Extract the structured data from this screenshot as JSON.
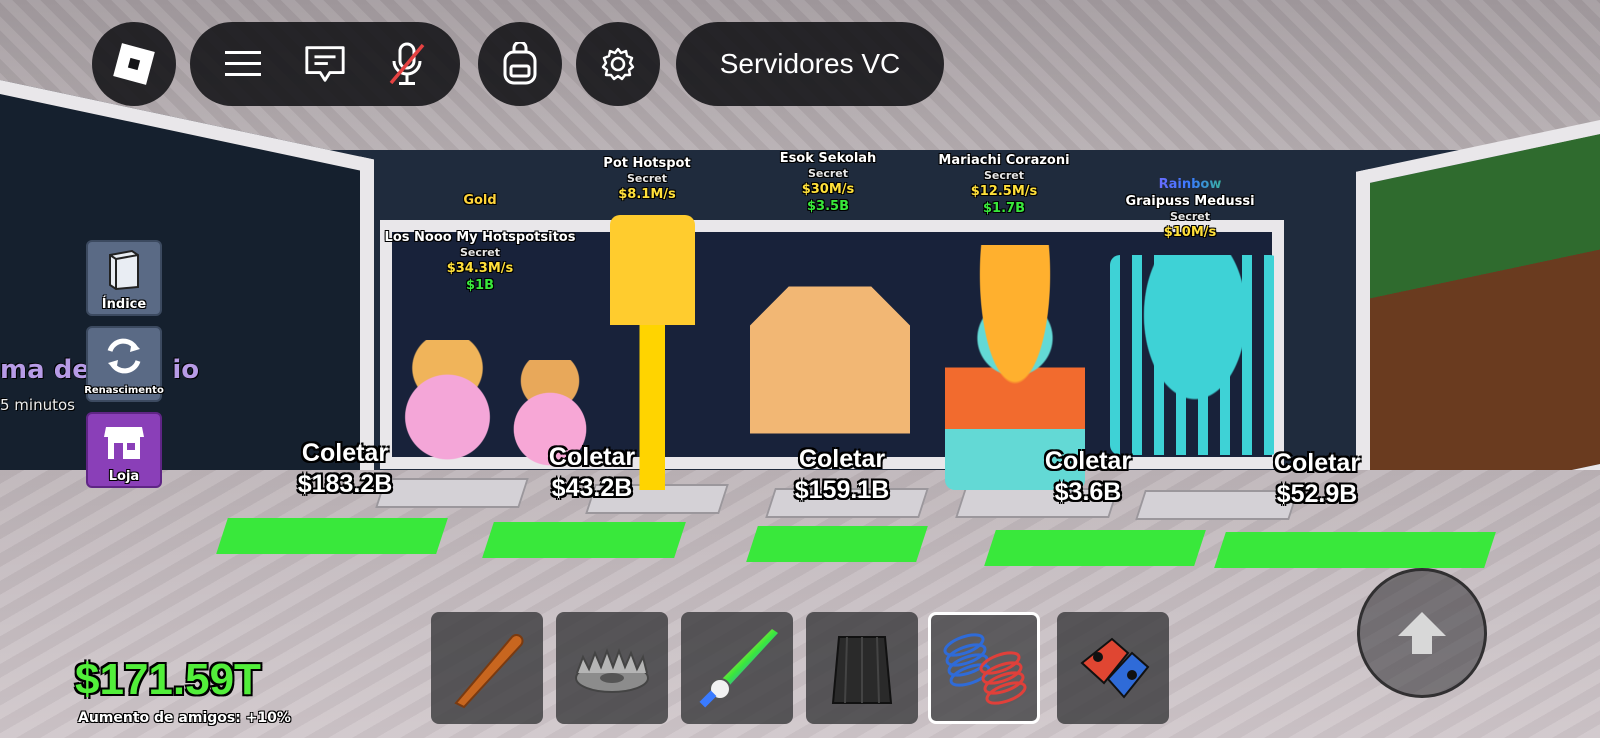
{
  "topbar": {
    "servers_label": "Servidores VC"
  },
  "side_menu": [
    {
      "label": "Índice",
      "icon": "book-icon",
      "color": "#5a6a85"
    },
    {
      "label": "Renascimento",
      "icon": "refresh-icon",
      "color": "#5a6a85"
    },
    {
      "label": "Loja",
      "icon": "shop-icon",
      "color": "#8a3fb8"
    }
  ],
  "offscreen_sign": {
    "title": "ma de C",
    "title_end": "io",
    "subtitle": "5 minutos"
  },
  "brainrots": [
    {
      "name": "Los Nooo My Hotspotsitos",
      "mutation": "Gold",
      "rarity": "Secret",
      "rate": "$34.3M/s",
      "price": "$1B",
      "collect_label": "Coletar",
      "collected": "$183.2B"
    },
    {
      "name": "",
      "mutation": "",
      "rarity": "",
      "rate": "",
      "price": "",
      "collect_label": "Coletar",
      "collected": "$43.2B"
    },
    {
      "name": "Pot Hotspot",
      "mutation": "",
      "rarity": "Secret",
      "rate": "$8.1M/s",
      "price": "",
      "collect_label": "",
      "collected": ""
    },
    {
      "name": "Esok Sekolah",
      "mutation": "",
      "rarity": "Secret",
      "rate": "$30M/s",
      "price": "$3.5B",
      "collect_label": "Coletar",
      "collected": "$159.1B"
    },
    {
      "name": "Mariachi Corazoni",
      "mutation": "",
      "rarity": "Secret",
      "rate": "$12.5M/s",
      "price": "$1.7B",
      "collect_label": "Coletar",
      "collected": "$3.6B"
    },
    {
      "name": "Graipuss Medussi",
      "mutation": "Rainbow",
      "rarity": "Secret",
      "rate": "$10M/s",
      "price": "",
      "collect_label": "Coletar",
      "collected": "$52.9B"
    }
  ],
  "hotbar": [
    {
      "item": "bat",
      "icon": "bat-icon",
      "selected": false
    },
    {
      "item": "trap",
      "icon": "trap-icon",
      "selected": false
    },
    {
      "item": "rainbow-sword",
      "icon": "sword-icon",
      "selected": false
    },
    {
      "item": "cape",
      "icon": "cape-icon",
      "selected": false
    },
    {
      "item": "coil",
      "icon": "coil-icon",
      "selected": true
    },
    {
      "item": "cloner",
      "icon": "cloner-icon",
      "selected": false
    }
  ],
  "player": {
    "money": "$171.59T",
    "bonus": "Aumento de amigos: +10%"
  },
  "colors": {
    "money_green": "#52ef3a",
    "pad_green": "#39e83b",
    "rate_yellow": "#ffe03a"
  }
}
